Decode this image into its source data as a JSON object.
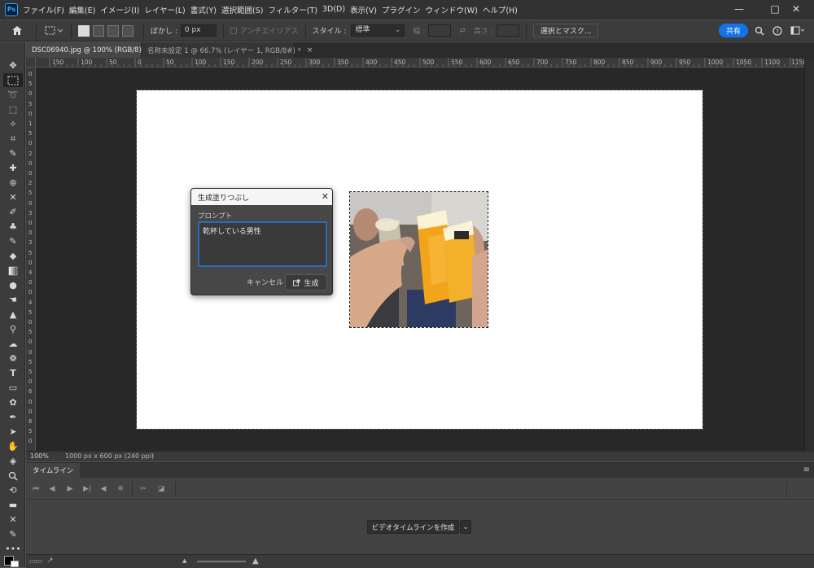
{
  "app": {
    "logo": "Ps",
    "menu": [
      "ファイル(F)",
      "編集(E)",
      "イメージ(I)",
      "レイヤー(L)",
      "書式(Y)",
      "選択範囲(S)",
      "フィルター(T)",
      "3D(D)",
      "表示(V)",
      "プラグイン",
      "ウィンドウ(W)",
      "ヘルプ(H)"
    ],
    "window_controls": {
      "minimize": "—",
      "maximize": "□",
      "close": "✕"
    }
  },
  "options_bar": {
    "feather_label": "ぼかし :",
    "feather_value": "0 px",
    "antialias_label": "アンチエイリアス",
    "style_label": "スタイル :",
    "style_value": "標準",
    "width_label": "幅 :",
    "height_label": "高さ :",
    "select_mask_label": "選択とマスク...",
    "share_label": "共有"
  },
  "tabs": [
    {
      "label": "DSC06940.jpg @ 100% (RGB/8) *",
      "close": "×",
      "active": true
    },
    {
      "label": "名称未設定 1 @ 66.7% (レイヤー 1, RGB/8#) *",
      "close": "×",
      "active": false
    }
  ],
  "rulers": {
    "horizontal": [
      "150",
      "100",
      "50",
      "0",
      "50",
      "100",
      "150",
      "200",
      "250",
      "300",
      "350",
      "400",
      "450",
      "500",
      "550",
      "600",
      "650",
      "700",
      "750",
      "800",
      "850",
      "900",
      "950",
      "1000",
      "1050",
      "1100",
      "1150"
    ],
    "vertical": [
      "0",
      "5",
      "0",
      "5",
      "0",
      "1",
      "5",
      "0",
      "2",
      "0",
      "0",
      "2",
      "5",
      "0",
      "3",
      "0",
      "0",
      "3",
      "5",
      "0",
      "4",
      "0",
      "0",
      "4",
      "5",
      "0",
      "5",
      "0",
      "0",
      "5",
      "5",
      "0",
      "6",
      "0",
      "0",
      "6",
      "5",
      "0"
    ]
  },
  "gen_fill": {
    "title": "生成塗りつぶし",
    "close": "✕",
    "prompt_label": "プロンプト",
    "prompt_value": "乾杯している男性",
    "cancel_label": "キャンセル",
    "generate_label": "生成"
  },
  "status": {
    "zoom": "100%",
    "doc_info": "1000 px x 600 px (240 ppi)",
    "arrow": "›"
  },
  "timeline": {
    "tab_label": "タイムライン",
    "create_label": "ビデオタイムラインを作成",
    "menu_icon": "≡"
  }
}
